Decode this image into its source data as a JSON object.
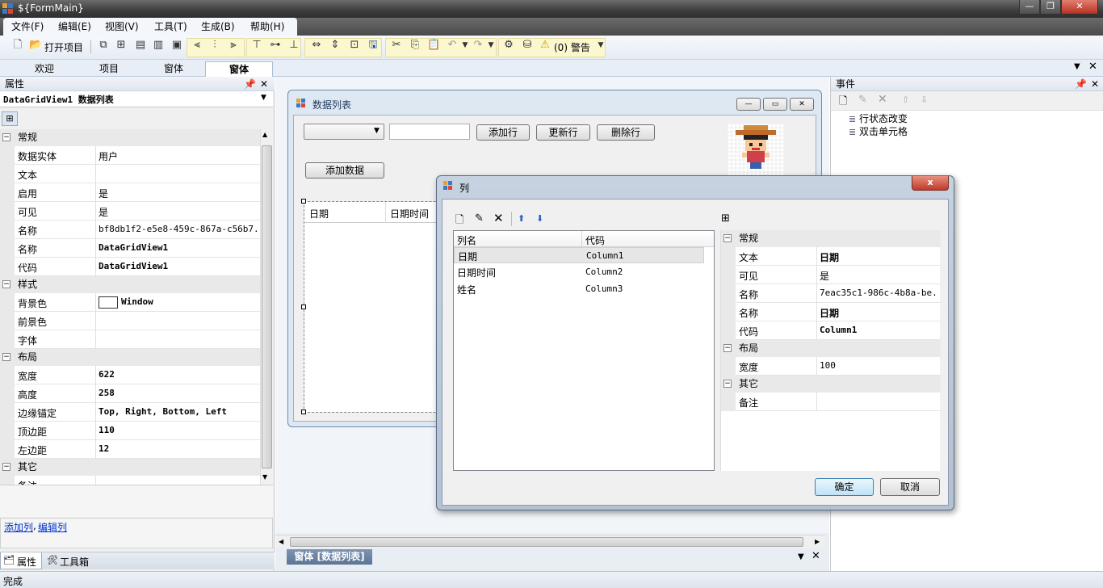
{
  "window": {
    "title": "${FormMain}"
  },
  "menu": [
    "文件(F)",
    "编辑(E)",
    "视图(V)",
    "工具(T)",
    "生成(B)",
    "帮助(H)"
  ],
  "toolbar": {
    "open_label": "打开项目",
    "warning_label": "(0) 警告"
  },
  "doc_tabs": [
    "欢迎",
    "项目",
    "窗体",
    "窗体"
  ],
  "properties": {
    "title": "属性",
    "object_selector": "DataGridView1 数据列表",
    "sections": [
      {
        "name": "常规",
        "rows": [
          {
            "label": "数据实体",
            "value": "用户"
          },
          {
            "label": "文本",
            "value": ""
          },
          {
            "label": "启用",
            "value": "是"
          },
          {
            "label": "可见",
            "value": "是"
          },
          {
            "label": "名称",
            "value": "bf8db1f2-e5e8-459c-867a-c56b7..."
          },
          {
            "label": "名称",
            "value": "DataGridView1"
          },
          {
            "label": "代码",
            "value": "DataGridView1"
          }
        ]
      },
      {
        "name": "样式",
        "rows": [
          {
            "label": "背景色",
            "value": "Window"
          },
          {
            "label": "前景色",
            "value": ""
          },
          {
            "label": "字体",
            "value": ""
          }
        ]
      },
      {
        "name": "布局",
        "rows": [
          {
            "label": "宽度",
            "value": "622"
          },
          {
            "label": "高度",
            "value": "258"
          },
          {
            "label": "边缘锚定",
            "value": "Top, Right, Bottom, Left"
          },
          {
            "label": "顶边距",
            "value": "110"
          },
          {
            "label": "左边距",
            "value": "12"
          }
        ]
      },
      {
        "name": "其它",
        "rows": [
          {
            "label": "备注",
            "value": ""
          }
        ]
      }
    ],
    "links": {
      "add_column": "添加列",
      "separator": ",",
      "edit_column": "编辑列"
    },
    "bottom_tabs": [
      "属性",
      "工具箱"
    ]
  },
  "designer": {
    "form_title": "数据列表",
    "buttons": {
      "add_row": "添加行",
      "update_row": "更新行",
      "delete_row": "删除行",
      "add_data": "添加数据"
    },
    "grid_headers": [
      "日期",
      "日期时间"
    ],
    "bottom_tab": "窗体 [数据列表]"
  },
  "events": {
    "title": "事件",
    "items": [
      "行状态改变",
      "双击单元格"
    ]
  },
  "dialog": {
    "title": "列",
    "close_glyph": "x",
    "list_headers": [
      "列名",
      "代码"
    ],
    "rows": [
      {
        "name": "日期",
        "code": "Column1"
      },
      {
        "name": "日期时间",
        "code": "Column2"
      },
      {
        "name": "姓名",
        "code": "Column3"
      }
    ],
    "props": {
      "sections": [
        {
          "name": "常规",
          "rows": [
            {
              "label": "文本",
              "value": "日期"
            },
            {
              "label": "可见",
              "value": "是"
            },
            {
              "label": "名称",
              "value": "7eac35c1-986c-4b8a-be..."
            },
            {
              "label": "名称",
              "value": "日期"
            },
            {
              "label": "代码",
              "value": "Column1"
            }
          ]
        },
        {
          "name": "布局",
          "rows": [
            {
              "label": "宽度",
              "value": "100"
            }
          ]
        },
        {
          "name": "其它",
          "rows": [
            {
              "label": "备注",
              "value": ""
            }
          ]
        }
      ]
    },
    "ok": "确定",
    "cancel": "取消"
  },
  "status": {
    "text": "完成"
  }
}
